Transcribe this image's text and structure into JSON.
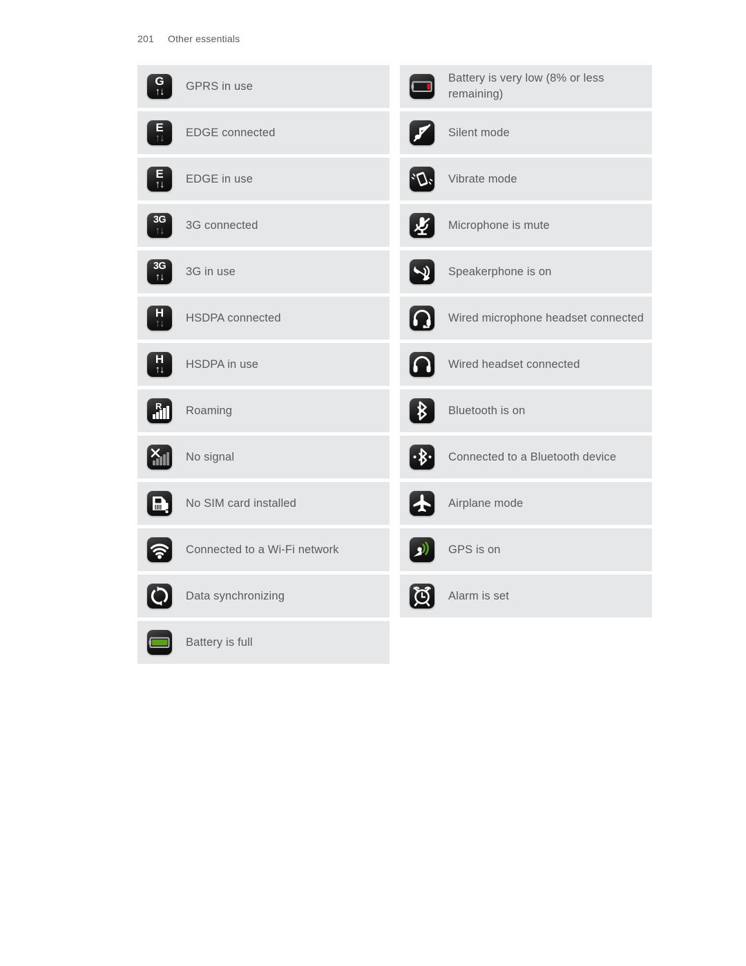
{
  "header": {
    "page_number": "201",
    "section": "Other essentials"
  },
  "colors": {
    "row_bg": "#e6e7e8",
    "text": "#58595b",
    "icon_tile_dark": "#121212",
    "battery_full_green": "#5aa01e",
    "battery_low_red": "#e01b1b",
    "gps_green": "#5aa01e",
    "page_bg": "#ffffff"
  },
  "columns": [
    {
      "name": "left-column",
      "rows": [
        {
          "icon": "gprs-in-use-icon",
          "label": "GPRS in use"
        },
        {
          "icon": "edge-connected-icon",
          "label": "EDGE connected"
        },
        {
          "icon": "edge-in-use-icon",
          "label": "EDGE in use"
        },
        {
          "icon": "3g-connected-icon",
          "label": "3G connected"
        },
        {
          "icon": "3g-in-use-icon",
          "label": "3G in use"
        },
        {
          "icon": "hsdpa-connected-icon",
          "label": "HSDPA connected"
        },
        {
          "icon": "hsdpa-in-use-icon",
          "label": "HSDPA in use"
        },
        {
          "icon": "roaming-icon",
          "label": "Roaming"
        },
        {
          "icon": "no-signal-icon",
          "label": "No signal"
        },
        {
          "icon": "no-sim-card-icon",
          "label": "No SIM card installed"
        },
        {
          "icon": "wifi-connected-icon",
          "label": "Connected to a Wi-Fi network"
        },
        {
          "icon": "data-sync-icon",
          "label": "Data synchronizing"
        },
        {
          "icon": "battery-full-icon",
          "label": "Battery is full"
        }
      ]
    },
    {
      "name": "right-column",
      "rows": [
        {
          "icon": "battery-very-low-icon",
          "label": "Battery is very low (8% or less remaining)"
        },
        {
          "icon": "silent-mode-icon",
          "label": "Silent mode"
        },
        {
          "icon": "vibrate-mode-icon",
          "label": "Vibrate mode"
        },
        {
          "icon": "microphone-mute-icon",
          "label": "Microphone is mute"
        },
        {
          "icon": "speakerphone-on-icon",
          "label": "Speakerphone is on"
        },
        {
          "icon": "wired-mic-headset-icon",
          "label": "Wired microphone headset connected"
        },
        {
          "icon": "wired-headset-icon",
          "label": "Wired headset connected"
        },
        {
          "icon": "bluetooth-on-icon",
          "label": "Bluetooth is on"
        },
        {
          "icon": "bluetooth-connected-icon",
          "label": "Connected to a Bluetooth device"
        },
        {
          "icon": "airplane-mode-icon",
          "label": "Airplane mode"
        },
        {
          "icon": "gps-on-icon",
          "label": "GPS is on"
        },
        {
          "icon": "alarm-set-icon",
          "label": "Alarm is set"
        }
      ]
    }
  ]
}
